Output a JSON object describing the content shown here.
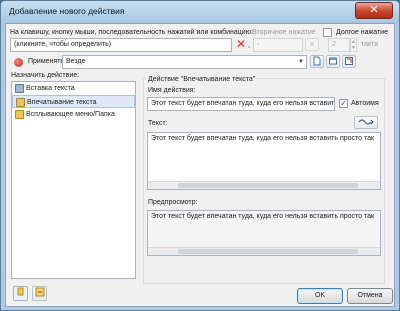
{
  "window": {
    "title": "Добавление нового действия",
    "close_glyph": "✕"
  },
  "trigger": {
    "prompt": "На клавишу, кнопку мыши, последовательность нажатий или комбинацию:",
    "input_placeholder": "(кликните, чтобы определить)",
    "secondary_label": "Вторичное нажатие",
    "secondary_value": "-",
    "long_press_label": "Долгое нажатие",
    "long_press_checked": false,
    "count_value": "2",
    "count_unit": "такта",
    "apply_label": "Применять",
    "apply_value": "Везде"
  },
  "assign": {
    "label": "Назначить действие:",
    "items": [
      {
        "label": "Вставка текста",
        "selected": false,
        "icon": "clipboard-icon"
      },
      {
        "label": "Впечатывание текста",
        "selected": true,
        "icon": "keyboard-icon"
      },
      {
        "label": "Всплывающее меню/Папка",
        "selected": false,
        "icon": "folder-icon"
      }
    ]
  },
  "action": {
    "group_title": "Действие \"Впечатывание текста\"",
    "name_label": "Имя действия:",
    "name_value": "Этот текст будет впечатан туда, куда его нельзя вставить",
    "auto_label": "Автоимя",
    "auto_checked": true,
    "text_label": "Текст:",
    "text_value": "Этот текст будет впечатан туда, куда его нельзя вставить просто так",
    "preview_label": "Предпросмотр:",
    "preview_value": "Этот текст будет впечатан туда, куда его нельзя вставить просто так"
  },
  "buttons": {
    "ok": "OK",
    "cancel": "Отмена"
  },
  "colors": {
    "accent_red": "#d9342b",
    "selection": "#dfe9f5"
  }
}
